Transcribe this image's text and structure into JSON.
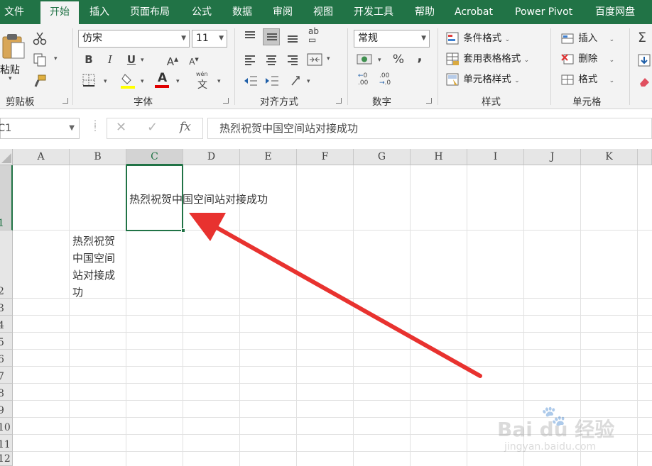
{
  "tabs": [
    "文件",
    "开始",
    "插入",
    "页面布局",
    "公式",
    "数据",
    "审阅",
    "视图",
    "开发工具",
    "帮助",
    "Acrobat",
    "Power Pivot",
    "百度网盘"
  ],
  "active_tab": "开始",
  "clipboard": {
    "paste_label": "粘贴",
    "group_label": "剪贴板"
  },
  "font": {
    "name": "仿宋",
    "size": "11",
    "bold": "B",
    "italic": "I",
    "underline": "U",
    "grow": "A",
    "shrink": "A",
    "font_color_glyph": "A",
    "phonetic": "文",
    "phonetic_top": "wén",
    "group_label": "字体"
  },
  "alignment": {
    "group_label": "对齐方式",
    "wrap_glyph": "ab"
  },
  "number": {
    "format": "常规",
    "percent": "%",
    "comma": ",",
    "inc_decimal": ".00",
    "dec_decimal": ".00",
    "group_label": "数字"
  },
  "styles": {
    "conditional": "条件格式",
    "table": "套用表格格式",
    "cell": "单元格样式",
    "group_label": "样式"
  },
  "cells": {
    "insert": "插入",
    "delete": "删除",
    "format": "格式",
    "group_label": "单元格"
  },
  "formula_bar": {
    "name_box": "C1",
    "fx": "fx",
    "content": "热烈祝贺中国空间站对接成功"
  },
  "columns": [
    "A",
    "B",
    "C",
    "D",
    "E",
    "F",
    "G",
    "H",
    "I",
    "J",
    "K"
  ],
  "selected_column": "C",
  "rows": [
    "1",
    "2",
    "3",
    "4",
    "5",
    "6",
    "7",
    "8",
    "9",
    "10",
    "11",
    "12"
  ],
  "selected_row": "1",
  "cell_C1": "热烈祝贺中国空间站对接成功",
  "cell_B2_lines": [
    "热烈祝贺",
    "中国空间",
    "站对接成",
    "功"
  ],
  "watermark": {
    "brand": "Bai du 经验",
    "url": "jingyan.baidu.com"
  },
  "colors": {
    "excel_green": "#217346",
    "arrow_red": "#e8322f"
  }
}
